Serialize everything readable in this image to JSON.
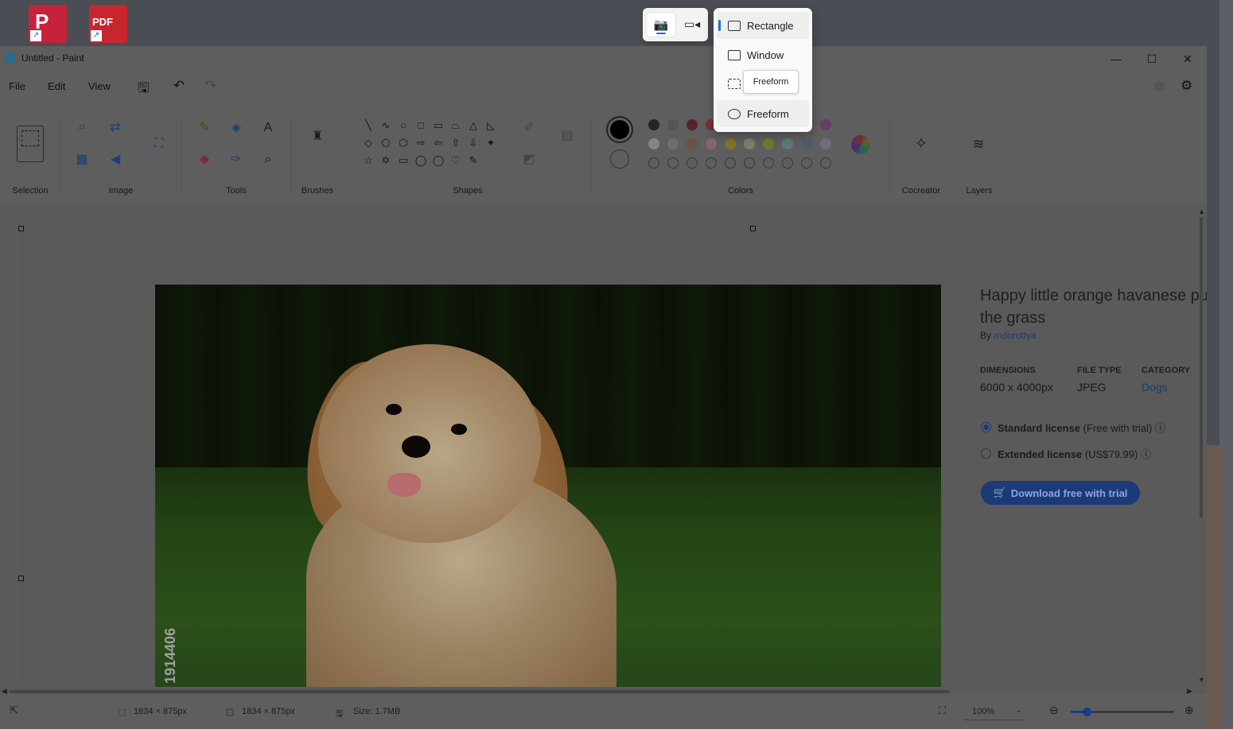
{
  "window": {
    "title": "Untitled - Paint",
    "minimize": "—",
    "maximize": "☐",
    "close": "✕"
  },
  "menu": {
    "file": "File",
    "edit": "Edit",
    "view": "View"
  },
  "ribbon": {
    "groups": {
      "selection": "Selection",
      "image": "Image",
      "tools": "Tools",
      "brushes": "Brushes",
      "shapes": "Shapes",
      "colors": "Colors",
      "cocreator": "Cocreator",
      "layers": "Layers"
    },
    "shape_glyphs": [
      "╲",
      "∿",
      "○",
      "□",
      "▭",
      "⏢",
      "△",
      "◺",
      "◇",
      "⬠",
      "⬡",
      "⇨",
      "⇦",
      "⇧",
      "⇩",
      "✦",
      "☆",
      "✡",
      "▭",
      "◯",
      "◯",
      "♡",
      "✎"
    ],
    "palette_row1": [
      "#000000",
      "#7f7f7f",
      "#880015",
      "#ed1c24",
      "#ff7f27",
      "#fff200",
      "#22b14c",
      "#00a2e8",
      "#3f48cc",
      "#a349a4"
    ],
    "palette_row2": [
      "#ffffff",
      "#c3c3c3",
      "#b97a57",
      "#ffaec9",
      "#ffc90e",
      "#efe4b0",
      "#b5e61d",
      "#99d9ea",
      "#7092be",
      "#c8bfe7"
    ],
    "primary_color": "#000000",
    "secondary_color": "#ffffff"
  },
  "photo": {
    "watermark": "1914406"
  },
  "listing": {
    "title": "Happy little orange havanese pu the grass",
    "by_label": "By",
    "author": "mdorottya",
    "dimensions_label": "DIMENSIONS",
    "dimensions_value": "6000 x 4000px",
    "filetype_label": "FILE TYPE",
    "filetype_value": "JPEG",
    "category_label": "CATEGORY",
    "category_value": "Dogs",
    "standard_license": "Standard license",
    "standard_note": "(Free with trial)",
    "extended_license": "Extended license",
    "extended_note": "(US$79.99)",
    "download_button": "Download free with trial"
  },
  "status": {
    "selection_size": "1834 × 875px",
    "canvas_size": "1834 × 875px",
    "file_size": "Size: 1.7MB",
    "zoom": "100%",
    "zoom_fraction": 0.15
  },
  "snipping": {
    "modes": [
      {
        "label": "Rectangle",
        "selected": true
      },
      {
        "label": "Window",
        "selected": false
      },
      {
        "label": "Freeform",
        "selected": false
      },
      {
        "label": "Freeform",
        "selected": false
      }
    ],
    "tooltip": "Freeform"
  }
}
